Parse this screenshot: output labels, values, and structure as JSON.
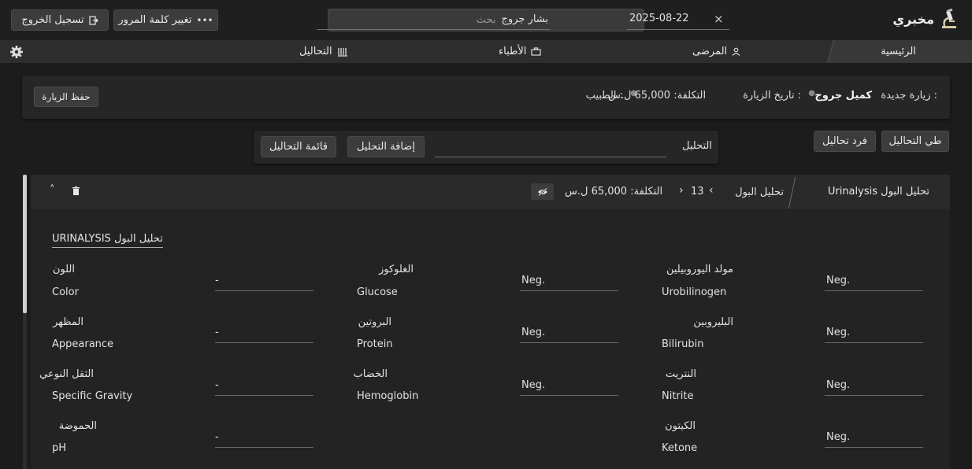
{
  "app": {
    "title": "مخبري"
  },
  "header": {
    "search_placeholder": "بحث",
    "logout_label": "تسجيل الخروج",
    "change_password_label": "تغيير كلمة المرور"
  },
  "nav": {
    "home": "الرئيسية",
    "patients": "المرضى",
    "doctors": "الأطباء",
    "analyses": "التحاليل"
  },
  "visit": {
    "title": "زيارة جديدة :",
    "patient_name": "كميل جروج",
    "date_label": "تاريخ الزيارة :",
    "date_value": "2025-08-22",
    "clear_symbol": "×",
    "doctor_label": "الطبيب :",
    "doctor_value": "بشار جروج",
    "cost": "التكلفة: 65,000 ل.س",
    "save_label": "حفظ الزيارة"
  },
  "toolbar": {
    "collapse_label": "طي التحاليل",
    "expand_label": "فرد تحاليل",
    "analysis_label": "التحليل",
    "add_label": "إضافة التحليل",
    "list_label": "قائمة التحاليل"
  },
  "card": {
    "name": "Urinalysis تحليل البول",
    "arabic_name": "تحليل البول",
    "count": "13",
    "cost": "التكلفة: 65,000 ل.س",
    "section_title": "URINALYSIS تحليل البول",
    "rows": [
      [
        {
          "ar": "مولد اليوروبيلين",
          "en": "Urobilinogen",
          "value": "Neg."
        },
        {
          "ar": "الغلوكوز",
          "en": "Glucose",
          "value": "Neg."
        },
        {
          "ar": "اللون",
          "en": "Color",
          "value": "-"
        }
      ],
      [
        {
          "ar": "البليروبين",
          "en": "Bilirubin",
          "value": "Neg."
        },
        {
          "ar": "البروتين",
          "en": "Protein",
          "value": "Neg."
        },
        {
          "ar": "المظهر",
          "en": "Appearance",
          "value": "-"
        }
      ],
      [
        {
          "ar": "النتريت",
          "en": "Nitrite",
          "value": "Neg."
        },
        {
          "ar": "الخضاب",
          "en": "Hemoglobin",
          "value": "Neg."
        },
        {
          "ar": "الثقل النوعي",
          "en": "Specific Gravity",
          "value": "-"
        }
      ],
      [
        {
          "ar": "الكيتون",
          "en": "Ketone",
          "value": "Neg."
        },
        {
          "ar": "الحموضة",
          "en": "pH",
          "value": "-"
        }
      ]
    ]
  },
  "icons": {
    "logo": "microscope-icon",
    "logout": "logout-icon",
    "password": "dots-icon",
    "patients": "person-icon",
    "doctors": "briefcase-icon",
    "analyses": "flask-icon",
    "settings": "gear-icon",
    "hide": "eye-off-icon",
    "delete": "trash-icon",
    "collapse": "chevron-up-icon"
  }
}
